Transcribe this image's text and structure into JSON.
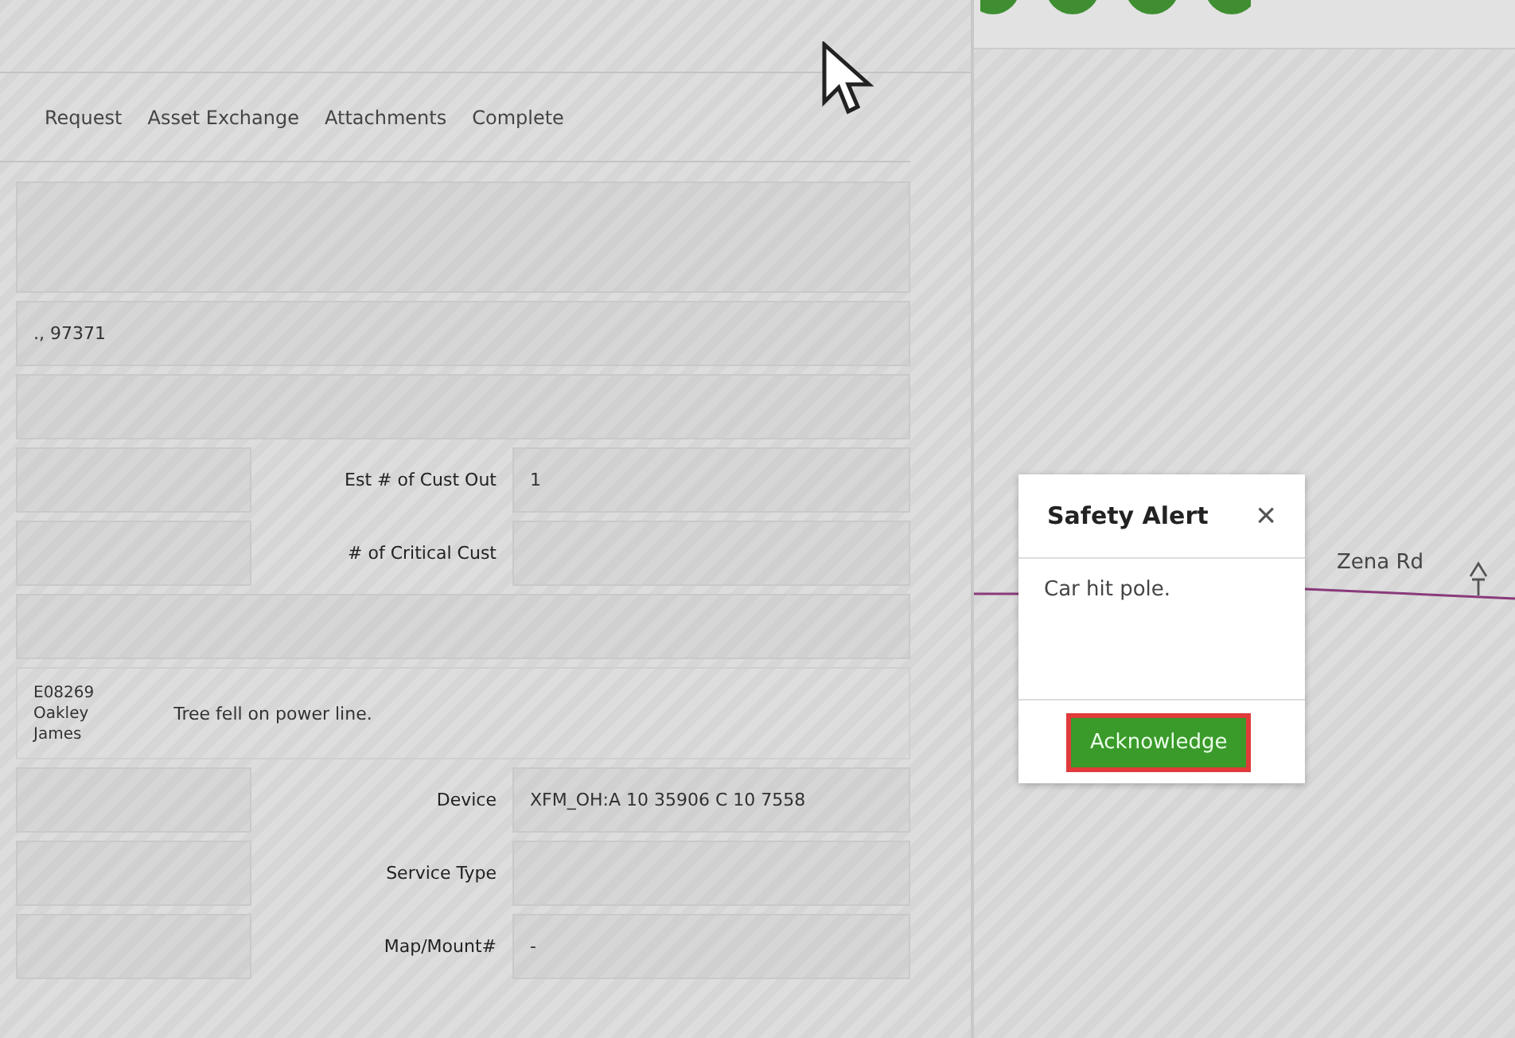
{
  "tabs": [
    {
      "label": "Request",
      "selected": false
    },
    {
      "label": "Asset Exchange",
      "selected": false
    },
    {
      "label": "Attachments",
      "selected": false
    },
    {
      "label": "Complete",
      "selected": false
    }
  ],
  "fields": [
    {
      "kind": "textarea"
    },
    {
      "kind": "full",
      "value": "., 97371"
    },
    {
      "kind": "full"
    },
    {
      "kind": "pair",
      "label": "Est # of Cust Out",
      "value": "1"
    },
    {
      "kind": "pair",
      "label": "# of Critical Cust"
    },
    {
      "kind": "full"
    },
    {
      "kind": "note",
      "author": [
        "E08269",
        "Oakley",
        "James"
      ],
      "text": "Tree fell on power line."
    },
    {
      "kind": "pair",
      "label": "Device",
      "value": "XFM_OH:A 10 35906 C 10 7558"
    },
    {
      "kind": "pair",
      "label": "Service Type"
    },
    {
      "kind": "pair",
      "label": "Map/Mount#",
      "value": "-"
    }
  ],
  "map": {
    "road_label": "Zena Rd"
  },
  "alert": {
    "title": "Safety Alert",
    "close": "×",
    "message": "Car hit pole.",
    "button": "Acknowledge"
  }
}
